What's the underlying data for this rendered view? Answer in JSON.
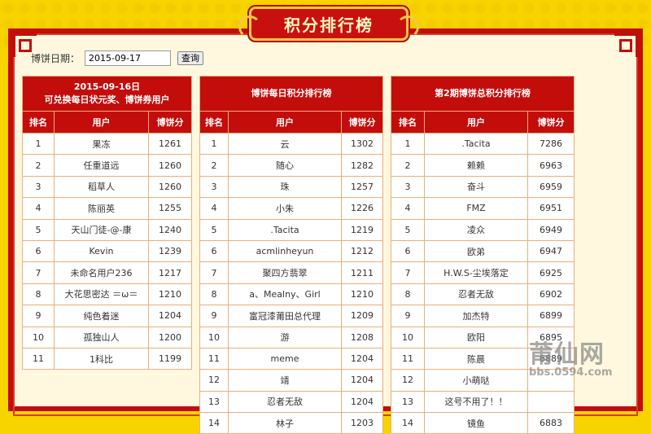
{
  "banner": {
    "title": "积分排行榜"
  },
  "date_filter": {
    "label": "博饼日期：",
    "value": "2015-09-17",
    "button": "查询"
  },
  "columns": {
    "rank": "排名",
    "user": "用户",
    "score": "博饼分"
  },
  "table1": {
    "title_line1": "2015-09-16日",
    "title_line2": "可兑换每日状元奖、博饼券用户",
    "rows": [
      {
        "rank": "1",
        "user": "果冻",
        "score": "1261"
      },
      {
        "rank": "2",
        "user": "任重道远",
        "score": "1260"
      },
      {
        "rank": "3",
        "user": "稻草人",
        "score": "1260"
      },
      {
        "rank": "4",
        "user": "陈丽英",
        "score": "1255"
      },
      {
        "rank": "5",
        "user": "天山门徒-@-康",
        "score": "1240"
      },
      {
        "rank": "6",
        "user": "Kevin",
        "score": "1239"
      },
      {
        "rank": "7",
        "user": "未命名用户236",
        "score": "1217"
      },
      {
        "rank": "8",
        "user": "大花思密达 ＝ω＝",
        "score": "1210"
      },
      {
        "rank": "9",
        "user": "纯色着迷",
        "score": "1204"
      },
      {
        "rank": "10",
        "user": "孤独山人",
        "score": "1200"
      },
      {
        "rank": "11",
        "user": "1科比",
        "score": "1199"
      }
    ]
  },
  "table2": {
    "title": "博饼每日积分排行榜",
    "rows": [
      {
        "rank": "1",
        "user": "云",
        "score": "1302"
      },
      {
        "rank": "2",
        "user": "随心",
        "score": "1282"
      },
      {
        "rank": "3",
        "user": "珠",
        "score": "1257"
      },
      {
        "rank": "4",
        "user": "小朱",
        "score": "1226"
      },
      {
        "rank": "5",
        "user": ".Tacita",
        "score": "1219"
      },
      {
        "rank": "6",
        "user": "acmlinheyun",
        "score": "1212"
      },
      {
        "rank": "7",
        "user": "聚四方翡翠",
        "score": "1211"
      },
      {
        "rank": "8",
        "user": "a、Mealny、Girl",
        "score": "1210"
      },
      {
        "rank": "9",
        "user": "富冠漆莆田总代理",
        "score": "1209"
      },
      {
        "rank": "10",
        "user": "游",
        "score": "1208"
      },
      {
        "rank": "11",
        "user": "meme",
        "score": "1204"
      },
      {
        "rank": "12",
        "user": "靖",
        "score": "1204"
      },
      {
        "rank": "13",
        "user": "忍者无敌",
        "score": "1204"
      },
      {
        "rank": "14",
        "user": "林子",
        "score": "1203"
      }
    ]
  },
  "table3": {
    "title": "第2期博饼总积分排行榜",
    "rows": [
      {
        "rank": "1",
        "user": ".Tacita",
        "score": "7286"
      },
      {
        "rank": "2",
        "user": "赖赖",
        "score": "6963"
      },
      {
        "rank": "3",
        "user": "奋斗",
        "score": "6959"
      },
      {
        "rank": "4",
        "user": "FMZ",
        "score": "6951"
      },
      {
        "rank": "5",
        "user": "凌众",
        "score": "6949"
      },
      {
        "rank": "6",
        "user": "欧弟",
        "score": "6947"
      },
      {
        "rank": "7",
        "user": "H.W.S-尘埃落定",
        "score": "6925"
      },
      {
        "rank": "8",
        "user": "忍者无敌",
        "score": "6902"
      },
      {
        "rank": "9",
        "user": "加杰特",
        "score": "6899"
      },
      {
        "rank": "10",
        "user": "欧阳",
        "score": "6895"
      },
      {
        "rank": "11",
        "user": "陈晨",
        "score": "6889"
      },
      {
        "rank": "12",
        "user": "小萌哒",
        "score": ""
      },
      {
        "rank": "13",
        "user": "这号不用了！！",
        "score": ""
      },
      {
        "rank": "14",
        "user": "镜鱼",
        "score": "6883"
      }
    ]
  },
  "watermark": {
    "main": "莆仙网",
    "sub": "bbs.0594.com"
  }
}
